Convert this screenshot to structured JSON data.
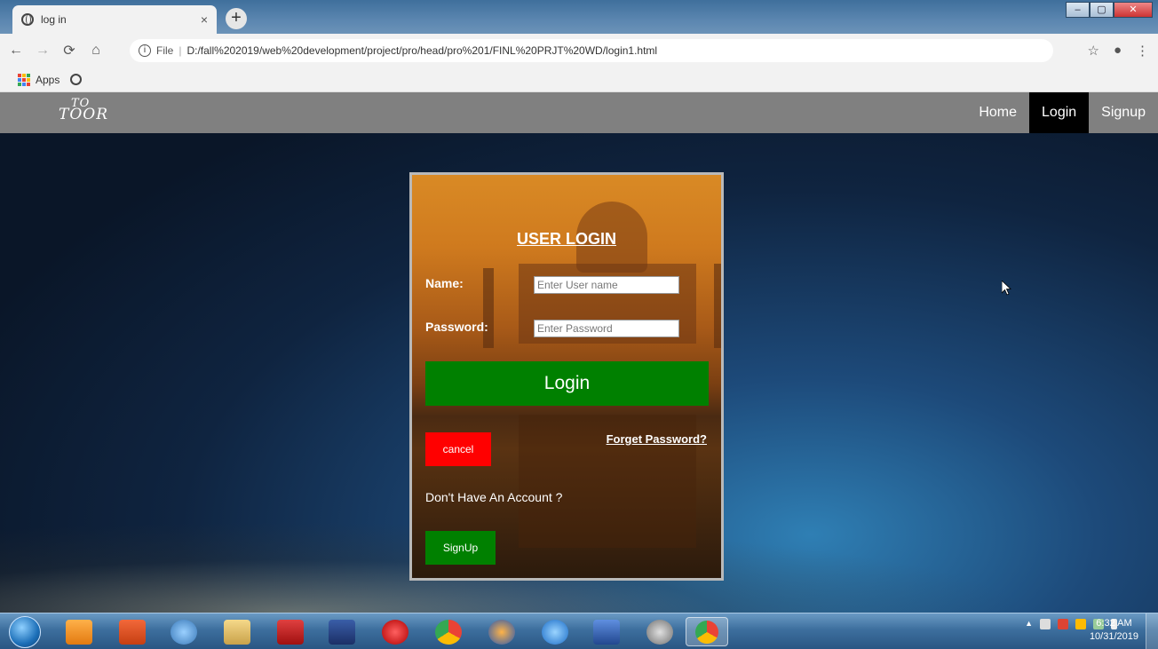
{
  "browser": {
    "tab_title": "log in",
    "tab_close": "×",
    "new_tab": "+",
    "address_scheme": "File",
    "address_url": "D:/fall%202019/web%20development/project/pro/head/pro%201/FINL%20PRJT%20WD/login1.html",
    "nav_icons": [
      "back-icon",
      "forward-icon",
      "reload-icon",
      "home-icon"
    ],
    "bookmarks": {
      "apps_label": "Apps"
    }
  },
  "site": {
    "logo_line1": "TO",
    "logo_line2": "TOOR",
    "nav": [
      {
        "label": "Home",
        "active": false
      },
      {
        "label": "Login",
        "active": true
      },
      {
        "label": "Signup",
        "active": false
      }
    ]
  },
  "login": {
    "title": "USER LOGIN",
    "name_label": "Name:",
    "name_placeholder": "Enter User name",
    "password_label": "Password:",
    "password_placeholder": "Enter Password",
    "login_button": "Login",
    "cancel_button": "cancel",
    "forgot_link": "Forget Password?",
    "no_account_text": "Don't Have An Account ?",
    "signup_button": "SignUp"
  },
  "taskbar": {
    "time": "6:32 AM",
    "date": "10/31/2019",
    "apps": [
      "vlc-icon",
      "powerpoint-icon",
      "calculator-icon",
      "file-explorer-icon",
      "acrobat-icon",
      "devcpp-icon",
      "opera-icon",
      "chrome-icon",
      "firefox-icon",
      "ie-icon",
      "word-icon",
      "app-icon",
      "chrome-active-icon"
    ]
  },
  "colors": {
    "navbar": "#808080",
    "nav_active": "#000000",
    "login_button": "#008000",
    "cancel_button": "#ff0000",
    "signup_button": "#008000"
  }
}
